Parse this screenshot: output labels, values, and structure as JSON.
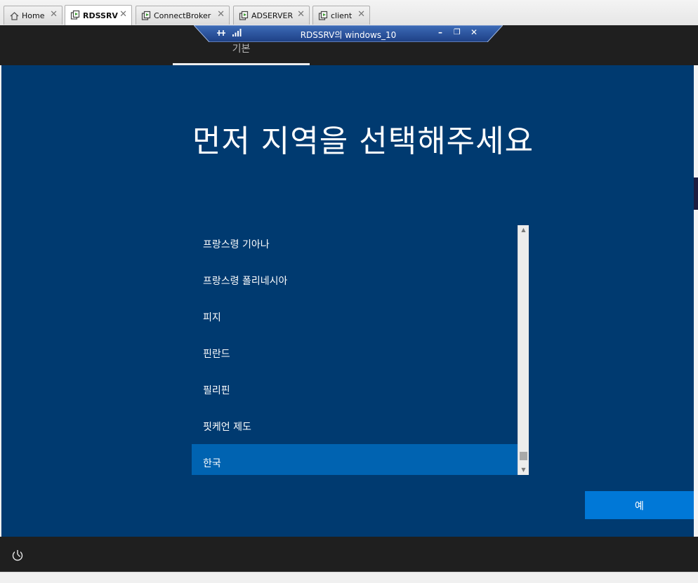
{
  "tabs": [
    {
      "label": "Home",
      "icon": "home-icon"
    },
    {
      "label": "RDSSRV",
      "icon": "vm-icon",
      "active": true
    },
    {
      "label": "ConnectBroker",
      "icon": "vm-icon"
    },
    {
      "label": "ADSERVER",
      "icon": "vm-icon"
    },
    {
      "label": "client",
      "icon": "vm-icon"
    }
  ],
  "tab_close_glyph": "✕",
  "connection_bar": {
    "title": "RDSSRV의 windows_10",
    "minimize": "–",
    "restore": "❐",
    "close": "✕"
  },
  "setup": {
    "step_tab": "기본",
    "headline": "먼저 지역을 선택해주세요",
    "regions": [
      "프랑스령 기아나",
      "프랑스령 폴리네시아",
      "피지",
      "핀란드",
      "필리핀",
      "핏케언 제도",
      "한국"
    ],
    "selected_region": "한국",
    "yes_button": "예"
  },
  "colors": {
    "background": "#003a70",
    "selected": "#0063b1",
    "button": "#0078d7",
    "bar": "#1f1f1f"
  }
}
